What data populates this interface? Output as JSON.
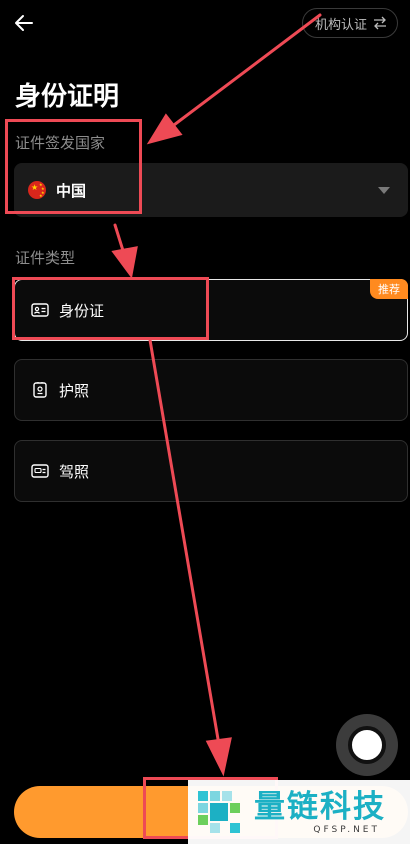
{
  "header": {
    "back_icon": "arrow-left-icon",
    "institution_button_label": "机构认证",
    "institution_icon": "swap-arrows-icon"
  },
  "page_title": "身份证明",
  "issuing_country": {
    "label": "证件签发国家",
    "selected_value": "中国",
    "flag_icon": "china-flag-icon",
    "dropdown_icon": "caret-down-icon"
  },
  "document_type": {
    "label": "证件类型",
    "options": [
      {
        "label": "身份证",
        "icon": "id-card-icon",
        "badge": "推荐",
        "selected": true
      },
      {
        "label": "护照",
        "icon": "passport-icon",
        "selected": false
      },
      {
        "label": "驾照",
        "icon": "drivers-license-icon",
        "selected": false
      }
    ]
  },
  "floating_assist_icon": "assistive-touch-icon",
  "colors": {
    "accent_orange": "#ff9a2e",
    "badge_orange": "#ff8a1f",
    "annotation_red": "#ee4a55",
    "watermark_teal": "#1cb0c4"
  },
  "watermark": {
    "text_cn": "量链科技",
    "text_en": "QFSP.NET",
    "logo_icon": "qfsp-logo-icon"
  }
}
